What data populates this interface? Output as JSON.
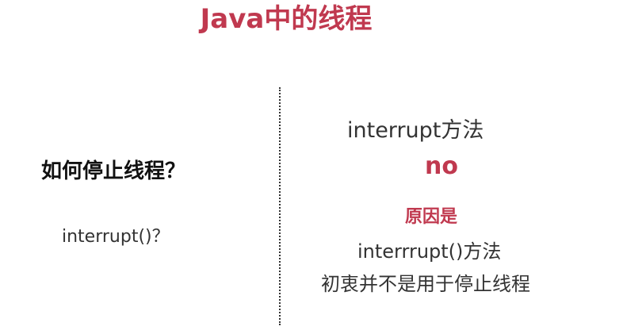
{
  "slide": {
    "title": "Java中的线程",
    "left": {
      "heading": "如何停止线程？",
      "sub": "interrupt()？"
    },
    "right": {
      "heading": "interrupt方法",
      "answer": "no",
      "reason_label": "原因是",
      "reason_line1": "interrrupt()方法",
      "reason_line2": "初衷并不是用于停止线程"
    }
  },
  "colors": {
    "accent": "#c0394f",
    "text_dark": "#111111",
    "text": "#333333",
    "background": "#ffffff"
  }
}
